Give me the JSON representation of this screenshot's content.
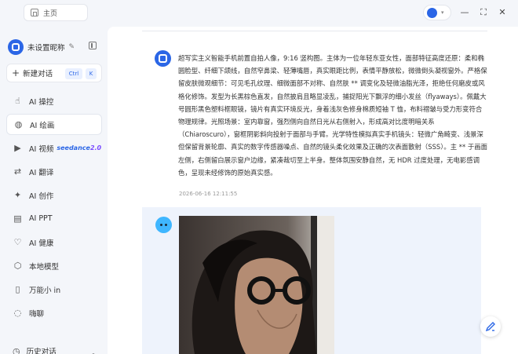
{
  "titlebar": {
    "home_tab": "主页",
    "window_controls": [
      "minimize-icon",
      "maximize-icon",
      "close-icon"
    ]
  },
  "sidebar": {
    "user_name": "未设置昵称",
    "new_chat": {
      "label": "新建对话",
      "shortcut": [
        "Ctrl",
        "K"
      ]
    },
    "items": [
      {
        "label": "AI 操控",
        "icon": "pointer-icon"
      },
      {
        "label": "AI 绘画",
        "icon": "palette-icon",
        "active": true
      },
      {
        "label": "AI 视频",
        "icon": "video-icon",
        "badge": "seedance",
        "badge_version": "2.0"
      },
      {
        "label": "AI 翻译",
        "icon": "translate-icon"
      },
      {
        "label": "AI 创作",
        "icon": "create-icon"
      },
      {
        "label": "AI PPT",
        "icon": "ppt-icon"
      },
      {
        "label": "AI 健康",
        "icon": "health-icon"
      },
      {
        "label": "本地模型",
        "icon": "cube-icon"
      },
      {
        "label": "万能小 in",
        "icon": "note-icon"
      },
      {
        "label": "嗨聊",
        "icon": "chat-icon"
      }
    ],
    "history_label": "历史对话"
  },
  "conversation": {
    "message": "超写实主义智能手机前置自拍人像，9:16 竖构图。主体为一位年轻东亚女性，面部特征高度还原：柔和椭圆脸型、纤细下颌线，自然窄鼻梁、轻薄嘴唇，真实眼距比例，表情平静放松，微微倒头凝视窗外。严格保留皮肤微观细节：可见毛孔纹理、细微面部不对称、自然肤 ** 调变化及轻微油脂光泽，拒绝任何磨皮或风格化修饰。发型为长黑棕色直发，自然披肩且略显凌乱，捕捉阳光下飘浮的细小发丝（flyaways）。佩戴大号圆形黑色塑料框眼镜，镜片有真实环境反光，身着浅灰色修身棉质短袖 T 恤，布料褶皱与受力形变符合物理规律。光照场景：室内靠窗，强烈侧向自然日光从右侧射入，形成高对比度明暗关系（Chiaroscuro），窗框阴影斜向投射于面部与手臂。光学特性模拟真实手机镜头：轻微广角畸变、浅景深但保留背景轮廓、真实的数字传感器噪点、自然的镜头柔化效果及正确的次表面散射（SSS）。主 ** 于画面左侧，右侧留白展示窗户边缘，紧凑裁切至上半身。整体氛围安静自然，无 HDR 过度处理，无电影感调色，呈现未经修饰的原始真实感。",
    "timestamp": "2026-06-16 12:11:55"
  },
  "colors": {
    "accent": "#2b66e6",
    "user_block_bg": "#eef3fc"
  }
}
